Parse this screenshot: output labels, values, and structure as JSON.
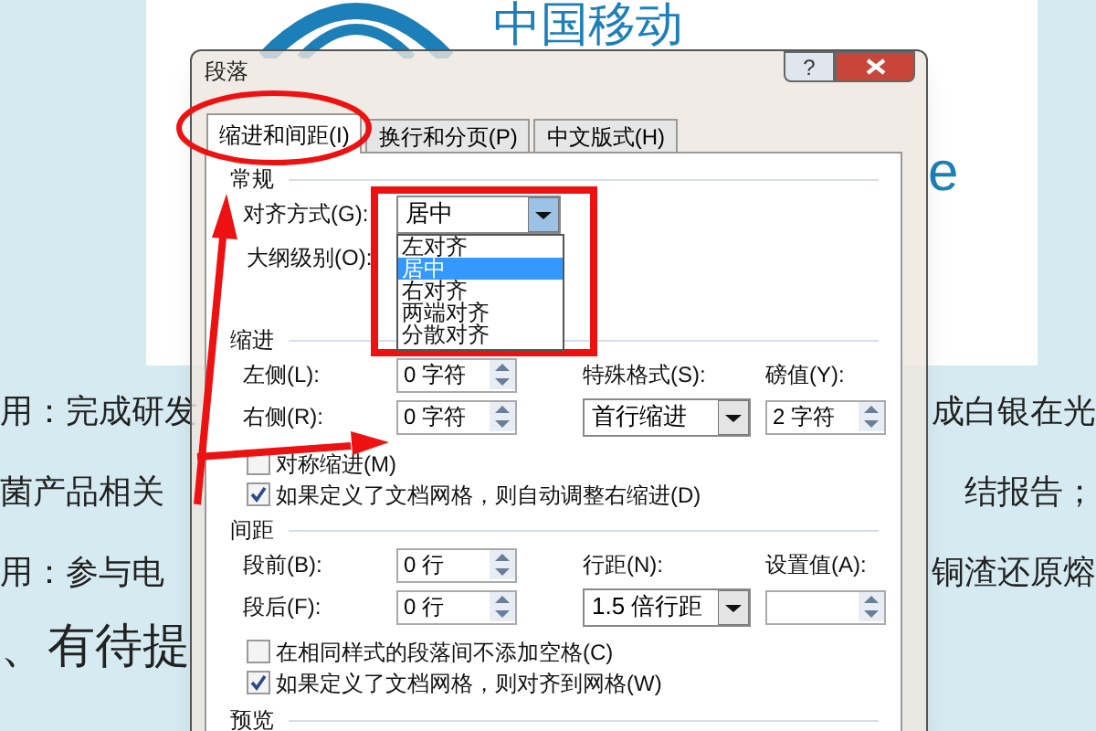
{
  "document": {
    "logo_text": "中国移动",
    "logo_fragment": "e",
    "lines": [
      {
        "left": "用：完成研发",
        "right": "成白银在光"
      },
      {
        "left": "菌产品相关",
        "right": "结报告；"
      },
      {
        "left": "用：参与电",
        "right": "铜渣还原熔"
      }
    ],
    "heading": "、有待提"
  },
  "dialog": {
    "title": "段落",
    "help_button": "?",
    "tabs": [
      {
        "label": "缩进和间距(I)",
        "selected": true
      },
      {
        "label": "换行和分页(P)",
        "selected": false
      },
      {
        "label": "中文版式(H)",
        "selected": false
      }
    ],
    "general": {
      "title": "常规",
      "alignment": {
        "label": "对齐方式(G):",
        "value": "居中",
        "expanded": true,
        "options": [
          {
            "label": "左对齐",
            "selected": false
          },
          {
            "label": "居中",
            "selected": true
          },
          {
            "label": "右对齐",
            "selected": false
          },
          {
            "label": "两端对齐",
            "selected": false
          },
          {
            "label": "分散对齐",
            "selected": false
          }
        ]
      },
      "outline_level": {
        "label": "大纲级别(O):"
      }
    },
    "indent": {
      "title": "缩进",
      "left": {
        "label": "左侧(L):",
        "value": "0 字符"
      },
      "right": {
        "label": "右侧(R):",
        "value": "0 字符"
      },
      "special": {
        "label": "特殊格式(S):",
        "value": "首行缩进"
      },
      "by": {
        "label": "磅值(Y):",
        "value": "2 字符"
      },
      "checkboxes": [
        {
          "label": "对称缩进(M)",
          "checked": false
        },
        {
          "label": "如果定义了文档网格，则自动调整右缩进(D)",
          "checked": true
        }
      ]
    },
    "spacing": {
      "title": "间距",
      "before": {
        "label": "段前(B):",
        "value": "0 行"
      },
      "after": {
        "label": "段后(F):",
        "value": "0 行"
      },
      "line_spacing": {
        "label": "行距(N):",
        "value": "1.5 倍行距"
      },
      "at": {
        "label": "设置值(A):"
      },
      "checkboxes": [
        {
          "label": "在相同样式的段落间不添加空格(C)",
          "checked": false
        },
        {
          "label": "如果定义了文档网格，则对齐到网格(W)",
          "checked": true
        }
      ]
    },
    "preview": {
      "title": "预览"
    }
  }
}
